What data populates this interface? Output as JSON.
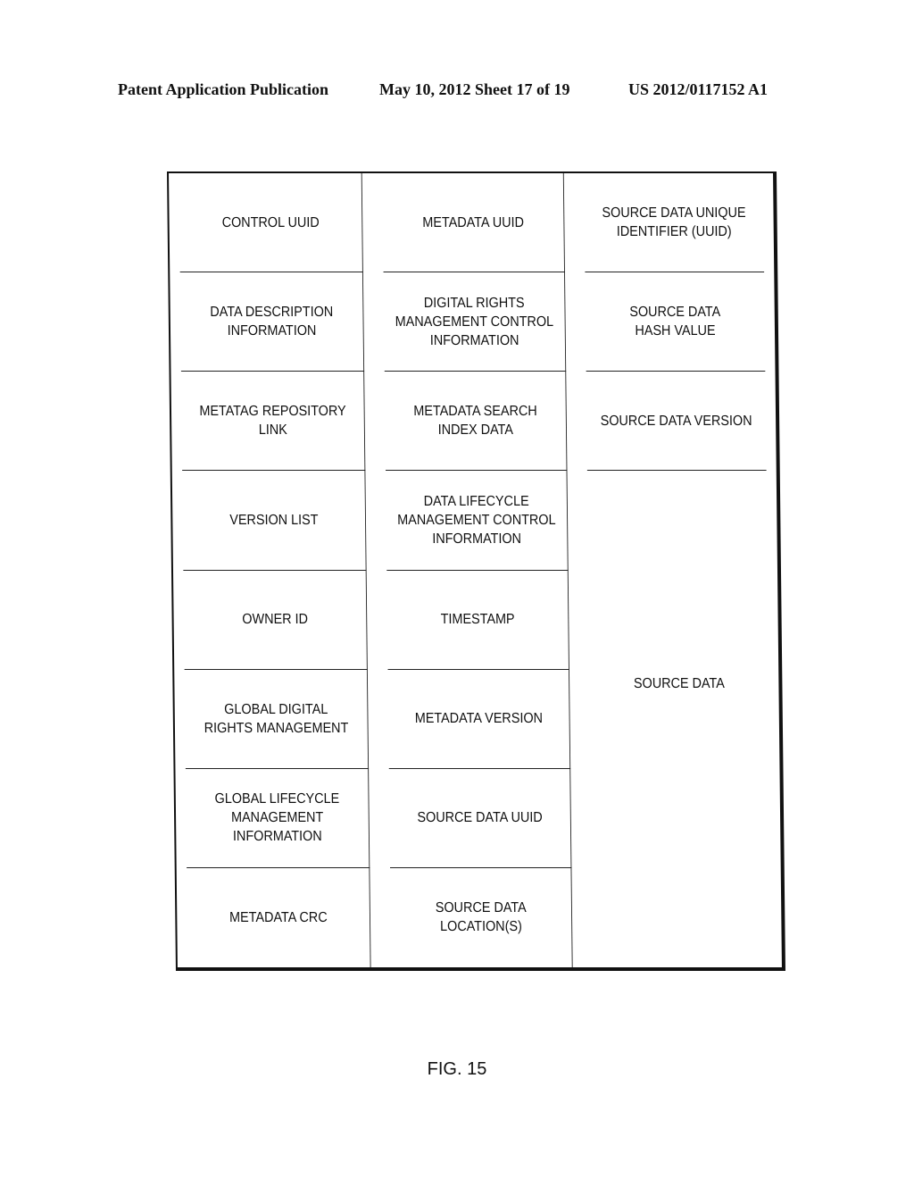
{
  "header": {
    "publication": "Patent Application Publication",
    "date_sheet": "May 10, 2012  Sheet 17 of 19",
    "number": "US 2012/0117152 A1"
  },
  "table": {
    "cells": [
      "CONTROL UUID",
      "METADATA UUID",
      "SOURCE DATA UNIQUE\nIDENTIFIER (UUID)",
      "DATA DESCRIPTION\nINFORMATION",
      "DIGITAL RIGHTS\nMANAGEMENT CONTROL\nINFORMATION",
      "SOURCE DATA\nHASH VALUE",
      "METATAG REPOSITORY LINK",
      "METADATA SEARCH\nINDEX DATA",
      "SOURCE DATA VERSION",
      "VERSION LIST",
      "DATA LIFECYCLE\nMANAGEMENT CONTROL\nINFORMATION",
      "OWNER ID",
      "TIMESTAMP",
      "GLOBAL DIGITAL\nRIGHTS MANAGEMENT",
      "METADATA VERSION",
      "GLOBAL LIFECYCLE\nMANAGEMENT INFORMATION",
      "SOURCE DATA UUID",
      "METADATA CRC",
      "SOURCE DATA\nLOCATION(S)"
    ],
    "source_data": "SOURCE DATA"
  },
  "figure_label": "FIG. 15"
}
